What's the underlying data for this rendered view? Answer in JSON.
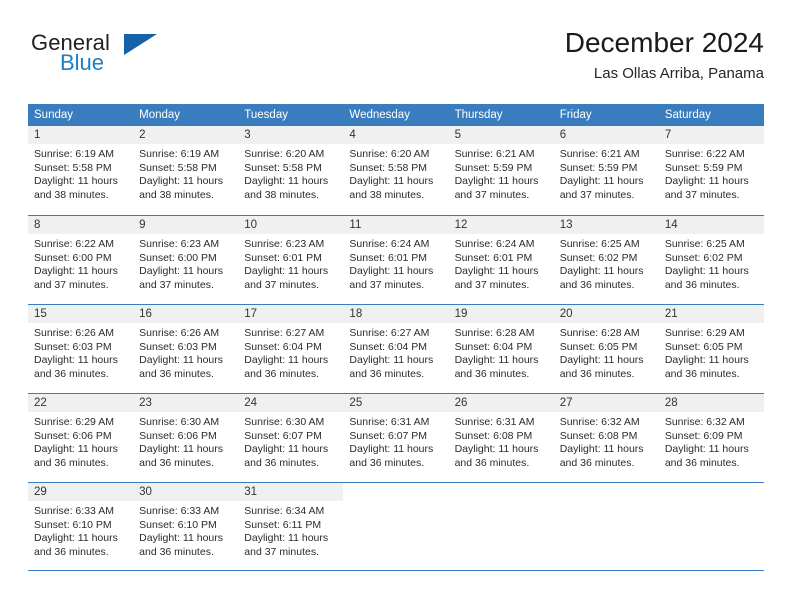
{
  "brand": {
    "name_top": "General",
    "name_bottom": "Blue",
    "accent_color": "#1463a8",
    "blue_text_color": "#1b7fc4"
  },
  "header": {
    "title": "December 2024",
    "subtitle": "Las Ollas Arriba, Panama"
  },
  "calendar": {
    "header_color": "#3a7dbf",
    "daynum_band_color": "#f0f0f0",
    "weekdays": [
      "Sunday",
      "Monday",
      "Tuesday",
      "Wednesday",
      "Thursday",
      "Friday",
      "Saturday"
    ],
    "weeks": [
      [
        {
          "day": "1",
          "sunrise": "Sunrise: 6:19 AM",
          "sunset": "Sunset: 5:58 PM",
          "daylight_1": "Daylight: 11 hours",
          "daylight_2": "and 38 minutes."
        },
        {
          "day": "2",
          "sunrise": "Sunrise: 6:19 AM",
          "sunset": "Sunset: 5:58 PM",
          "daylight_1": "Daylight: 11 hours",
          "daylight_2": "and 38 minutes."
        },
        {
          "day": "3",
          "sunrise": "Sunrise: 6:20 AM",
          "sunset": "Sunset: 5:58 PM",
          "daylight_1": "Daylight: 11 hours",
          "daylight_2": "and 38 minutes."
        },
        {
          "day": "4",
          "sunrise": "Sunrise: 6:20 AM",
          "sunset": "Sunset: 5:58 PM",
          "daylight_1": "Daylight: 11 hours",
          "daylight_2": "and 38 minutes."
        },
        {
          "day": "5",
          "sunrise": "Sunrise: 6:21 AM",
          "sunset": "Sunset: 5:59 PM",
          "daylight_1": "Daylight: 11 hours",
          "daylight_2": "and 37 minutes."
        },
        {
          "day": "6",
          "sunrise": "Sunrise: 6:21 AM",
          "sunset": "Sunset: 5:59 PM",
          "daylight_1": "Daylight: 11 hours",
          "daylight_2": "and 37 minutes."
        },
        {
          "day": "7",
          "sunrise": "Sunrise: 6:22 AM",
          "sunset": "Sunset: 5:59 PM",
          "daylight_1": "Daylight: 11 hours",
          "daylight_2": "and 37 minutes."
        }
      ],
      [
        {
          "day": "8",
          "sunrise": "Sunrise: 6:22 AM",
          "sunset": "Sunset: 6:00 PM",
          "daylight_1": "Daylight: 11 hours",
          "daylight_2": "and 37 minutes."
        },
        {
          "day": "9",
          "sunrise": "Sunrise: 6:23 AM",
          "sunset": "Sunset: 6:00 PM",
          "daylight_1": "Daylight: 11 hours",
          "daylight_2": "and 37 minutes."
        },
        {
          "day": "10",
          "sunrise": "Sunrise: 6:23 AM",
          "sunset": "Sunset: 6:01 PM",
          "daylight_1": "Daylight: 11 hours",
          "daylight_2": "and 37 minutes."
        },
        {
          "day": "11",
          "sunrise": "Sunrise: 6:24 AM",
          "sunset": "Sunset: 6:01 PM",
          "daylight_1": "Daylight: 11 hours",
          "daylight_2": "and 37 minutes."
        },
        {
          "day": "12",
          "sunrise": "Sunrise: 6:24 AM",
          "sunset": "Sunset: 6:01 PM",
          "daylight_1": "Daylight: 11 hours",
          "daylight_2": "and 37 minutes."
        },
        {
          "day": "13",
          "sunrise": "Sunrise: 6:25 AM",
          "sunset": "Sunset: 6:02 PM",
          "daylight_1": "Daylight: 11 hours",
          "daylight_2": "and 36 minutes."
        },
        {
          "day": "14",
          "sunrise": "Sunrise: 6:25 AM",
          "sunset": "Sunset: 6:02 PM",
          "daylight_1": "Daylight: 11 hours",
          "daylight_2": "and 36 minutes."
        }
      ],
      [
        {
          "day": "15",
          "sunrise": "Sunrise: 6:26 AM",
          "sunset": "Sunset: 6:03 PM",
          "daylight_1": "Daylight: 11 hours",
          "daylight_2": "and 36 minutes."
        },
        {
          "day": "16",
          "sunrise": "Sunrise: 6:26 AM",
          "sunset": "Sunset: 6:03 PM",
          "daylight_1": "Daylight: 11 hours",
          "daylight_2": "and 36 minutes."
        },
        {
          "day": "17",
          "sunrise": "Sunrise: 6:27 AM",
          "sunset": "Sunset: 6:04 PM",
          "daylight_1": "Daylight: 11 hours",
          "daylight_2": "and 36 minutes."
        },
        {
          "day": "18",
          "sunrise": "Sunrise: 6:27 AM",
          "sunset": "Sunset: 6:04 PM",
          "daylight_1": "Daylight: 11 hours",
          "daylight_2": "and 36 minutes."
        },
        {
          "day": "19",
          "sunrise": "Sunrise: 6:28 AM",
          "sunset": "Sunset: 6:04 PM",
          "daylight_1": "Daylight: 11 hours",
          "daylight_2": "and 36 minutes."
        },
        {
          "day": "20",
          "sunrise": "Sunrise: 6:28 AM",
          "sunset": "Sunset: 6:05 PM",
          "daylight_1": "Daylight: 11 hours",
          "daylight_2": "and 36 minutes."
        },
        {
          "day": "21",
          "sunrise": "Sunrise: 6:29 AM",
          "sunset": "Sunset: 6:05 PM",
          "daylight_1": "Daylight: 11 hours",
          "daylight_2": "and 36 minutes."
        }
      ],
      [
        {
          "day": "22",
          "sunrise": "Sunrise: 6:29 AM",
          "sunset": "Sunset: 6:06 PM",
          "daylight_1": "Daylight: 11 hours",
          "daylight_2": "and 36 minutes."
        },
        {
          "day": "23",
          "sunrise": "Sunrise: 6:30 AM",
          "sunset": "Sunset: 6:06 PM",
          "daylight_1": "Daylight: 11 hours",
          "daylight_2": "and 36 minutes."
        },
        {
          "day": "24",
          "sunrise": "Sunrise: 6:30 AM",
          "sunset": "Sunset: 6:07 PM",
          "daylight_1": "Daylight: 11 hours",
          "daylight_2": "and 36 minutes."
        },
        {
          "day": "25",
          "sunrise": "Sunrise: 6:31 AM",
          "sunset": "Sunset: 6:07 PM",
          "daylight_1": "Daylight: 11 hours",
          "daylight_2": "and 36 minutes."
        },
        {
          "day": "26",
          "sunrise": "Sunrise: 6:31 AM",
          "sunset": "Sunset: 6:08 PM",
          "daylight_1": "Daylight: 11 hours",
          "daylight_2": "and 36 minutes."
        },
        {
          "day": "27",
          "sunrise": "Sunrise: 6:32 AM",
          "sunset": "Sunset: 6:08 PM",
          "daylight_1": "Daylight: 11 hours",
          "daylight_2": "and 36 minutes."
        },
        {
          "day": "28",
          "sunrise": "Sunrise: 6:32 AM",
          "sunset": "Sunset: 6:09 PM",
          "daylight_1": "Daylight: 11 hours",
          "daylight_2": "and 36 minutes."
        }
      ],
      [
        {
          "day": "29",
          "sunrise": "Sunrise: 6:33 AM",
          "sunset": "Sunset: 6:10 PM",
          "daylight_1": "Daylight: 11 hours",
          "daylight_2": "and 36 minutes."
        },
        {
          "day": "30",
          "sunrise": "Sunrise: 6:33 AM",
          "sunset": "Sunset: 6:10 PM",
          "daylight_1": "Daylight: 11 hours",
          "daylight_2": "and 36 minutes."
        },
        {
          "day": "31",
          "sunrise": "Sunrise: 6:34 AM",
          "sunset": "Sunset: 6:11 PM",
          "daylight_1": "Daylight: 11 hours",
          "daylight_2": "and 37 minutes."
        },
        {
          "day": "",
          "sunrise": "",
          "sunset": "",
          "daylight_1": "",
          "daylight_2": ""
        },
        {
          "day": "",
          "sunrise": "",
          "sunset": "",
          "daylight_1": "",
          "daylight_2": ""
        },
        {
          "day": "",
          "sunrise": "",
          "sunset": "",
          "daylight_1": "",
          "daylight_2": ""
        },
        {
          "day": "",
          "sunrise": "",
          "sunset": "",
          "daylight_1": "",
          "daylight_2": ""
        }
      ]
    ]
  }
}
